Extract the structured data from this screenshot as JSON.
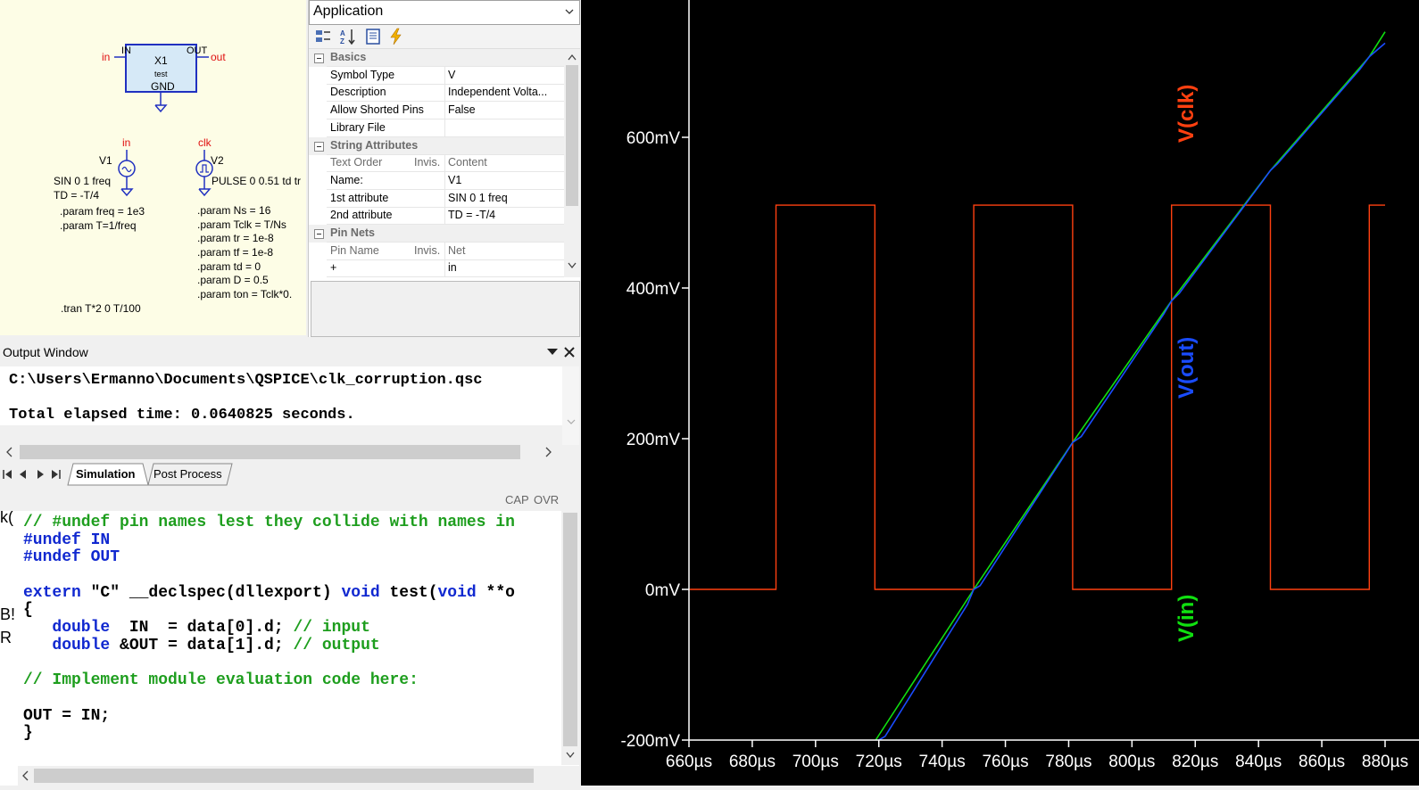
{
  "schematic": {
    "subckt": {
      "ref": "X1",
      "model": "test",
      "pin_in": "IN",
      "pin_out": "OUT",
      "pin_gnd": "GND",
      "net_in": "in",
      "net_out": "out"
    },
    "v1": {
      "net": "in",
      "ref": "V1",
      "line1": "SIN 0 1 freq",
      "line2": "TD = -T/4"
    },
    "v2": {
      "net": "clk",
      "ref": "V2",
      "line1": "PULSE 0 0.51 td tr"
    },
    "params_left": [
      ".param freq = 1e3",
      ".param T=1/freq"
    ],
    "params_right": [
      ".param Ns = 16",
      ".param Tclk = T/Ns",
      ".param tr = 1e-8",
      ".param tf = 1e-8",
      ".param td = 0",
      ".param D = 0.5",
      ".param ton = Tclk*0."
    ],
    "tran": ".tran T*2 0 T/100"
  },
  "props": {
    "header": "Application",
    "rows": [
      {
        "type": "cat",
        "key": "Basics"
      },
      {
        "type": "row",
        "key": "Symbol Type",
        "value": "V"
      },
      {
        "type": "row",
        "key": "Description",
        "value": "Independent Volta..."
      },
      {
        "type": "row",
        "key": "Allow Shorted Pins",
        "value": "False"
      },
      {
        "type": "row",
        "key": "Library File",
        "value": ""
      },
      {
        "type": "cat",
        "key": "String Attributes"
      },
      {
        "type": "sub",
        "key": "Text Order",
        "mid": "Invis.",
        "value": "Content"
      },
      {
        "type": "row",
        "key": "    Name:",
        "value": "V1"
      },
      {
        "type": "row",
        "key": "1st attribute",
        "value": "SIN 0 1 freq"
      },
      {
        "type": "row",
        "key": "2nd attribute",
        "value": "TD = -T/4"
      },
      {
        "type": "cat",
        "key": "Pin Nets"
      },
      {
        "type": "sub",
        "key": "Pin Name",
        "mid": "Invis.",
        "value": "Net"
      },
      {
        "type": "row",
        "key": "+",
        "value": "in"
      }
    ]
  },
  "output": {
    "title": "Output Window",
    "lines": [
      "C:\\Users\\Ermanno\\Documents\\QSPICE\\clk_corruption.qsc",
      "Total elapsed time: 0.0640825 seconds."
    ],
    "tabs": [
      "Simulation",
      "Post Process"
    ],
    "status": [
      "CAP",
      "OVR"
    ]
  },
  "code": {
    "lines": [
      [
        [
          "c-com",
          "// #undef pin names lest they collide with names in"
        ]
      ],
      [
        [
          "c-kw",
          "#undef IN"
        ]
      ],
      [
        [
          "c-kw",
          "#undef OUT"
        ]
      ],
      [
        [
          "c-txt",
          ""
        ]
      ],
      [
        [
          "c-kw",
          "extern"
        ],
        [
          "c-txt",
          " \"C\" __declspec(dllexport) "
        ],
        [
          "c-kw",
          "void"
        ],
        [
          "c-txt",
          " test("
        ],
        [
          "c-kw",
          "void"
        ],
        [
          "c-txt",
          " **o"
        ]
      ],
      [
        [
          "c-txt",
          "{"
        ]
      ],
      [
        [
          "c-txt",
          "   "
        ],
        [
          "c-kw",
          "double"
        ],
        [
          "c-txt",
          "  IN  = data[0].d; "
        ],
        [
          "c-com",
          "// input"
        ]
      ],
      [
        [
          "c-txt",
          "   "
        ],
        [
          "c-kw",
          "double"
        ],
        [
          "c-txt",
          " &OUT = data[1].d; "
        ],
        [
          "c-com",
          "// output"
        ]
      ],
      [
        [
          "c-txt",
          ""
        ]
      ],
      [
        [
          "c-com",
          "// Implement module evaluation code here:"
        ]
      ],
      [
        [
          "c-txt",
          ""
        ]
      ],
      [
        [
          "c-txt",
          "OUT = IN;"
        ]
      ],
      [
        [
          "c-txt",
          "}"
        ]
      ]
    ],
    "gutter": [
      "k(",
      "B!",
      "R"
    ]
  },
  "plot": {
    "colors": {
      "clk": "#ff4010",
      "out": "#1a4cff",
      "in": "#10e010",
      "axis": "#ffffff"
    }
  },
  "chart_data": {
    "type": "line",
    "xlabel": "",
    "ylabel": "",
    "xlim": [
      660,
      880
    ],
    "ylim": [
      -200,
      760
    ],
    "x_unit": "µs",
    "y_unit": "mV",
    "xticks": [
      "660µs",
      "680µs",
      "700µs",
      "720µs",
      "740µs",
      "760µs",
      "780µs",
      "800µs",
      "820µs",
      "840µs",
      "860µs",
      "880µs"
    ],
    "yticks": [
      "600mV",
      "400mV",
      "200mV",
      "0mV",
      "-200mV"
    ],
    "ytick_values": [
      600,
      400,
      200,
      0,
      -200
    ],
    "series": [
      {
        "name": "V(clk)",
        "x": [
          660,
          687.5,
          687.5,
          718.75,
          718.75,
          750,
          750,
          781.25,
          781.25,
          812.5,
          812.5,
          843.75,
          843.75,
          875,
          875,
          880
        ],
        "values": [
          0,
          0,
          510,
          510,
          0,
          0,
          510,
          510,
          0,
          0,
          510,
          510,
          0,
          0,
          510,
          510
        ]
      },
      {
        "name": "V(in)",
        "x": [
          719,
          750,
          781.25,
          812.5,
          843.75,
          875,
          880
        ],
        "values": [
          -200,
          0,
          195,
          383,
          556,
          707,
          740
        ]
      },
      {
        "name": "V(out)",
        "x": [
          720,
          722,
          748,
          750,
          752,
          779,
          781.25,
          784,
          810,
          812.5,
          815,
          841,
          843.75,
          846,
          872,
          875,
          880
        ],
        "values": [
          -200,
          -195,
          -20,
          0,
          5,
          180,
          195,
          203,
          365,
          383,
          393,
          540,
          556,
          565,
          690,
          707,
          725
        ]
      }
    ]
  }
}
